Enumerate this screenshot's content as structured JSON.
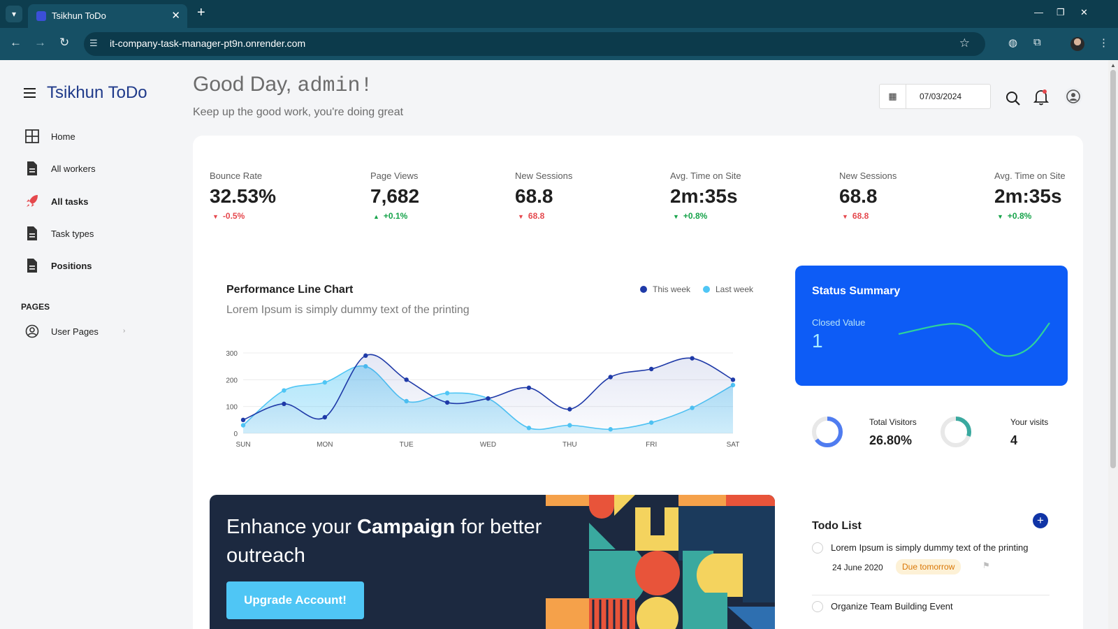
{
  "browser": {
    "tab_title": "Tsikhun ToDo",
    "url": "it-company-task-manager-pt9n.onrender.com"
  },
  "sidebar": {
    "brand": "Tsikhun ToDo",
    "items": [
      {
        "label": "Home",
        "icon": "grid-icon"
      },
      {
        "label": "All workers",
        "icon": "document-icon"
      },
      {
        "label": "All tasks",
        "icon": "rocket-icon"
      },
      {
        "label": "Task types",
        "icon": "document-icon"
      },
      {
        "label": "Positions",
        "icon": "document-icon"
      }
    ],
    "pages_header": "PAGES",
    "user_pages": "User Pages"
  },
  "header": {
    "greeting_prefix": "Good Day,",
    "username": "admin!",
    "subtitle": "Keep up the good work, you're doing great",
    "date": "07/03/2024"
  },
  "stats": [
    {
      "label": "Bounce Rate",
      "value": "32.53%",
      "delta": "-0.5%",
      "direction": "down"
    },
    {
      "label": "Page Views",
      "value": "7,682",
      "delta": "+0.1%",
      "direction": "up"
    },
    {
      "label": "New Sessions",
      "value": "68.8",
      "delta": "68.8",
      "direction": "down"
    },
    {
      "label": "Avg. Time on Site",
      "value": "2m:35s",
      "delta": "+0.8%",
      "direction": "up"
    },
    {
      "label": "New Sessions",
      "value": "68.8",
      "delta": "68.8",
      "direction": "down"
    },
    {
      "label": "Avg. Time on Site",
      "value": "2m:35s",
      "delta": "+0.8%",
      "direction": "up"
    }
  ],
  "performance": {
    "title": "Performance Line Chart",
    "subtitle": "Lorem Ipsum is simply dummy text of the printing",
    "legend_this_week": "This week",
    "legend_last_week": "Last week"
  },
  "chart_data": {
    "type": "area",
    "x": [
      "SUN",
      "MON",
      "TUE",
      "WED",
      "THU",
      "FRI",
      "SAT"
    ],
    "yticks": [
      0,
      100,
      200,
      300
    ],
    "ylim": [
      0,
      300
    ],
    "series": [
      {
        "name": "This week",
        "color": "#1f3aa8",
        "values": [
          50,
          110,
          60,
          290,
          200,
          115,
          130,
          170,
          90,
          210,
          240,
          280,
          200
        ]
      },
      {
        "name": "Last week",
        "color": "#4fc6f5",
        "values": [
          30,
          160,
          190,
          250,
          120,
          150,
          130,
          20,
          30,
          15,
          40,
          95,
          180
        ]
      }
    ],
    "x_positions": [
      0,
      0.5,
      1,
      1.5,
      2,
      2.5,
      3,
      3.5,
      4,
      4.5,
      5,
      5.5,
      6
    ],
    "grid": true
  },
  "status_summary": {
    "title": "Status Summary",
    "closed_label": "Closed Value",
    "closed_value": "1"
  },
  "visitors": {
    "total_label": "Total Visitors",
    "total_value": "26.80%",
    "total_fraction": 0.65,
    "your_label": "Your visits",
    "your_value": "4",
    "your_fraction": 0.3
  },
  "banner": {
    "text_prefix": "Enhance your",
    "text_bold": "Campaign",
    "text_suffix": "for better outreach",
    "button": "Upgrade Account!"
  },
  "todo": {
    "title": "Todo List",
    "items": [
      {
        "text": "Lorem Ipsum is simply dummy text of the printing",
        "date": "24 June 2020",
        "badge": "Due tomorrow"
      },
      {
        "text": "Organize Team Building Event"
      }
    ]
  },
  "colors": {
    "brand": "#1f3a8a",
    "accent": "#0d5cf6",
    "up": "#16a34a",
    "down": "#e5484d"
  }
}
